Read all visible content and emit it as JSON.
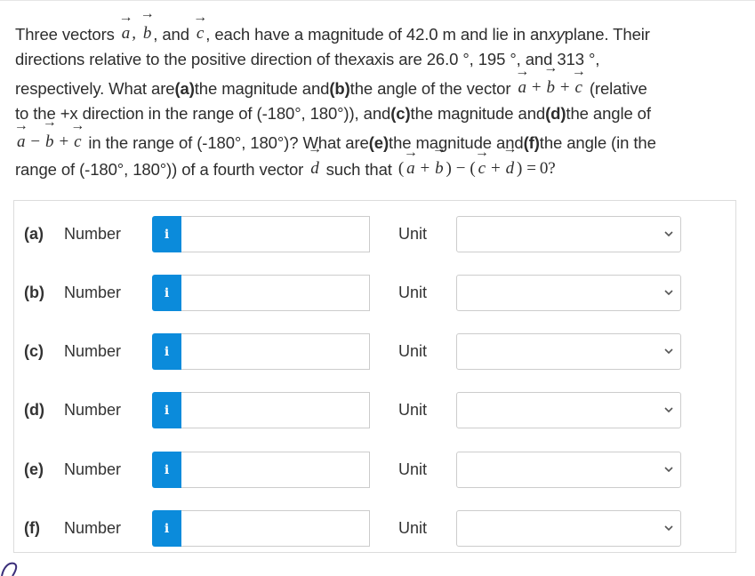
{
  "question": {
    "line1": {
      "t1": "Three vectors",
      "va": "a",
      "comma1": ",",
      "vb": "b",
      "t2": ", and",
      "vc": "c",
      "t3": ", each have a magnitude of 42.0 m and lie in an ",
      "xy": "xy",
      "t4": " plane. Their"
    },
    "line2": {
      "t1": "directions relative to the positive direction of the ",
      "x": "x",
      "t2": " axis are 26.0 °, 195 °, and 313 °,"
    },
    "line3": {
      "t1": "respectively. What are ",
      "pa": "(a)",
      "t2": " the magnitude and ",
      "pb": "(b)",
      "t3": " the angle of the vector",
      "va": "a",
      "plus1": "+",
      "vb": "b",
      "plus2": "+",
      "vc": "c",
      "t4": "(relative"
    },
    "line4": {
      "t1": "to the +x direction in the range of (-180°, 180°)), and ",
      "pc": "(c)",
      "t2": " the magnitude and ",
      "pd": "(d)",
      "t3": " the angle of"
    },
    "line5": {
      "va": "a",
      "minus": "−",
      "vb": "b",
      "plus": "+",
      "vc": "c",
      "t1": "in the range of (-180°, 180°)? What are ",
      "pe": "(e)",
      "t2": " the magnitude and ",
      "pf": "(f)",
      "t3": " the angle (in the"
    },
    "line6": {
      "t1": "range of (-180°, 180°)) of a fourth vector",
      "vd": "d",
      "t2": "such that",
      "lp1": "(",
      "va": "a",
      "plus1": "+",
      "vb": "b",
      "rp1": ")",
      "minus": "−",
      "lp2": "(",
      "vc": "c",
      "plus2": "+",
      "vd2": "d",
      "rp2": ")",
      "eq": "=",
      "zero": "0?"
    },
    "arrow_glyph": "→"
  },
  "answers": [
    {
      "part": "(a)",
      "number_label": "Number",
      "info_icon": "i",
      "number_value": "",
      "unit_label": "Unit",
      "unit_value": ""
    },
    {
      "part": "(b)",
      "number_label": "Number",
      "info_icon": "i",
      "number_value": "",
      "unit_label": "Unit",
      "unit_value": ""
    },
    {
      "part": "(c)",
      "number_label": "Number",
      "info_icon": "i",
      "number_value": "",
      "unit_label": "Unit",
      "unit_value": ""
    },
    {
      "part": "(d)",
      "number_label": "Number",
      "info_icon": "i",
      "number_value": "",
      "unit_label": "Unit",
      "unit_value": ""
    },
    {
      "part": "(e)",
      "number_label": "Number",
      "info_icon": "i",
      "number_value": "",
      "unit_label": "Unit",
      "unit_value": ""
    },
    {
      "part": "(f)",
      "number_label": "Number",
      "info_icon": "i",
      "number_value": "",
      "unit_label": "Unit",
      "unit_value": ""
    }
  ],
  "colors": {
    "info_button": "#0b8bdb",
    "border": "#cccccc",
    "text": "#333333"
  }
}
